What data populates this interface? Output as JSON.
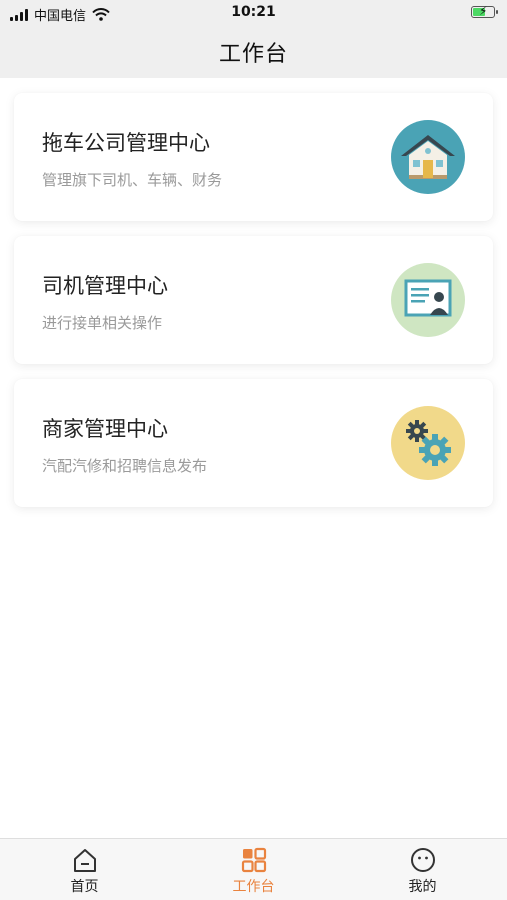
{
  "status_bar": {
    "carrier": "中国电信",
    "time": "10:21"
  },
  "header": {
    "title": "工作台"
  },
  "cards": [
    {
      "title": "拖车公司管理中心",
      "subtitle": "管理旗下司机、车辆、财务",
      "icon": "house-icon",
      "icon_bg": "#4aa3b5"
    },
    {
      "title": "司机管理中心",
      "subtitle": "进行接单相关操作",
      "icon": "id-card-icon",
      "icon_bg": "#cfe6c2"
    },
    {
      "title": "商家管理中心",
      "subtitle": "汽配汽修和招聘信息发布",
      "icon": "gears-icon",
      "icon_bg": "#f1d98a"
    }
  ],
  "tabbar": {
    "items": [
      {
        "label": "首页",
        "icon": "home-icon",
        "active": false
      },
      {
        "label": "工作台",
        "icon": "grid-icon",
        "active": true
      },
      {
        "label": "我的",
        "icon": "smiley-icon",
        "active": false
      }
    ],
    "active_color": "#e9833f"
  }
}
